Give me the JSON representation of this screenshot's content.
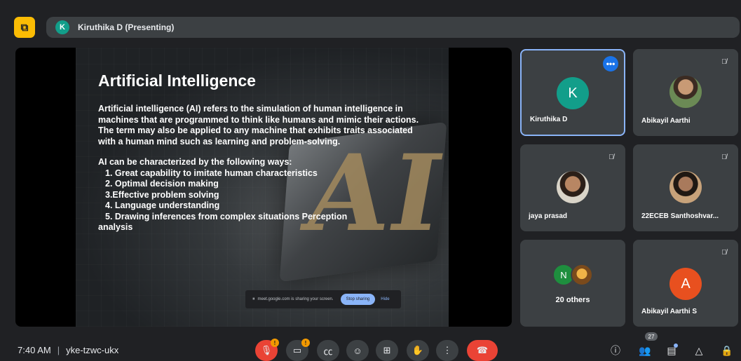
{
  "topbar": {
    "presenter_initial": "K",
    "presenter_label": "Kiruthika D (Presenting)",
    "pip_icon": "picture-in-picture-off-icon"
  },
  "slide": {
    "title": "Artificial Intelligence",
    "para1": "Artificial intelligence (AI) refers to the simulation of human intelligence in machines that are programmed to think like humans and mimic their actions.",
    "para2": " The term may also be applied to any machine that exhibits traits associated with a human mind such as learning and problem-solving.",
    "lead": "AI can be characterized by the following ways:",
    "items": [
      "1. Great capability to imitate human characteristics",
      "2. Optimal decision making",
      "3.Effective problem solving",
      "4. Language understanding",
      "5. Drawing inferences from complex situations Perception"
    ],
    "tail": "analysis",
    "bg_text": "AI"
  },
  "share_bar": {
    "message": "meet.google.com is sharing your screen.",
    "stop_label": "Stop sharing",
    "hide_label": "Hide"
  },
  "participants": [
    {
      "name": "Kiruthika D",
      "initial": "K",
      "color": "#129e8a",
      "active": true
    },
    {
      "name": "Abikayil Aarthi",
      "muted": true
    },
    {
      "name": "jaya prasad",
      "muted": true
    },
    {
      "name": "22ECEB Santhoshvar...",
      "muted": true
    },
    {
      "name": "20 others",
      "initial": "N",
      "color": "#1e8e3e"
    },
    {
      "name": "Abikayil Aarthi S",
      "initial": "A",
      "color": "#e8501f",
      "muted": true
    }
  ],
  "bottombar": {
    "time": "7:40 AM",
    "separator": "|",
    "meeting_code": "yke-tzwc-ukx",
    "mic_badge": "!",
    "cam_badge": "!",
    "people_count": "27"
  },
  "colors": {
    "background": "#202124",
    "tile": "#3c4043",
    "active_border": "#8ab4f8",
    "danger": "#ea4335",
    "warning": "#f29900"
  }
}
